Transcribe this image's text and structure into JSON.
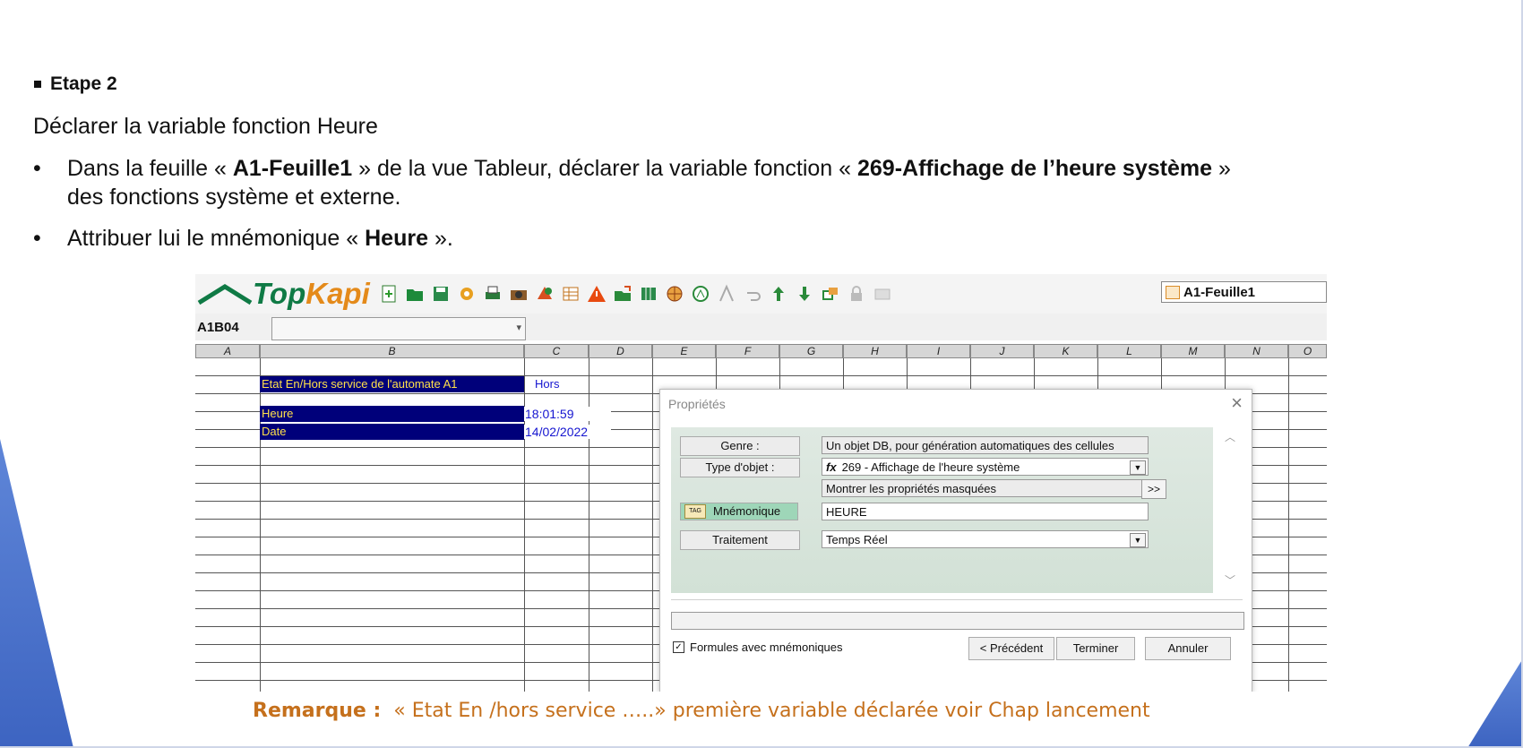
{
  "step_title": "Etape 2",
  "intro": "Déclarer la variable fonction Heure",
  "bullets": {
    "b1_pre": "Dans la feuille « ",
    "b1_sheet": "A1-Feuille1",
    "b1_mid": " » de la vue Tableur, déclarer la variable fonction « ",
    "b1_func": "269-Affichage de l’heure système",
    "b1_post": " »",
    "b1_line2": "des fonctions système et externe.",
    "b2_pre": "Attribuer lui le mnémonique « ",
    "b2_name": "Heure",
    "b2_post": " »."
  },
  "app": {
    "logo_part1": "Top",
    "logo_part2": "Kapi",
    "sheet_name": "A1-Feuille1",
    "cell_ref": "A1B04",
    "columns": [
      "A",
      "B",
      "C",
      "D",
      "E",
      "F",
      "G",
      "H",
      "I",
      "J",
      "K",
      "L",
      "M",
      "N",
      "O"
    ]
  },
  "sheet": {
    "etat_label": "Etat En/Hors service de l'automate A1",
    "etat_value": "Hors",
    "heure_label": "Heure",
    "heure_value": "18:01:59",
    "date_label": "Date",
    "date_value": "14/02/2022"
  },
  "dialog": {
    "title": "Propriétés",
    "close": "×",
    "genre_label": "Genre :",
    "genre_value": "Un objet DB, pour génération automatiques des cellules",
    "type_label": "Type d'objet :",
    "type_value": "269 - Affichage de l'heure système",
    "show_hidden": "Montrer les propriétés masquées",
    "more": ">>",
    "mnemo_label": "Mnémonique",
    "mnemo_value": "HEURE",
    "traitement_label": "Traitement",
    "traitement_value": "Temps Réel",
    "checkbox_label": "Formules avec mnémoniques",
    "btn_prev": "< Précédent",
    "btn_finish": "Terminer",
    "btn_cancel": "Annuler"
  },
  "remark": {
    "label": "Remarque :",
    "text": "« Etat En /hors service …..» première variable déclarée voir Chap lancement"
  },
  "colors": {
    "brand_green": "#0f7a45",
    "brand_orange": "#e48a1a",
    "cell_navy": "#00007a",
    "cell_yellow": "#ffe04a",
    "remark": "#c5701c",
    "deco_blue": "#4a72cc"
  }
}
